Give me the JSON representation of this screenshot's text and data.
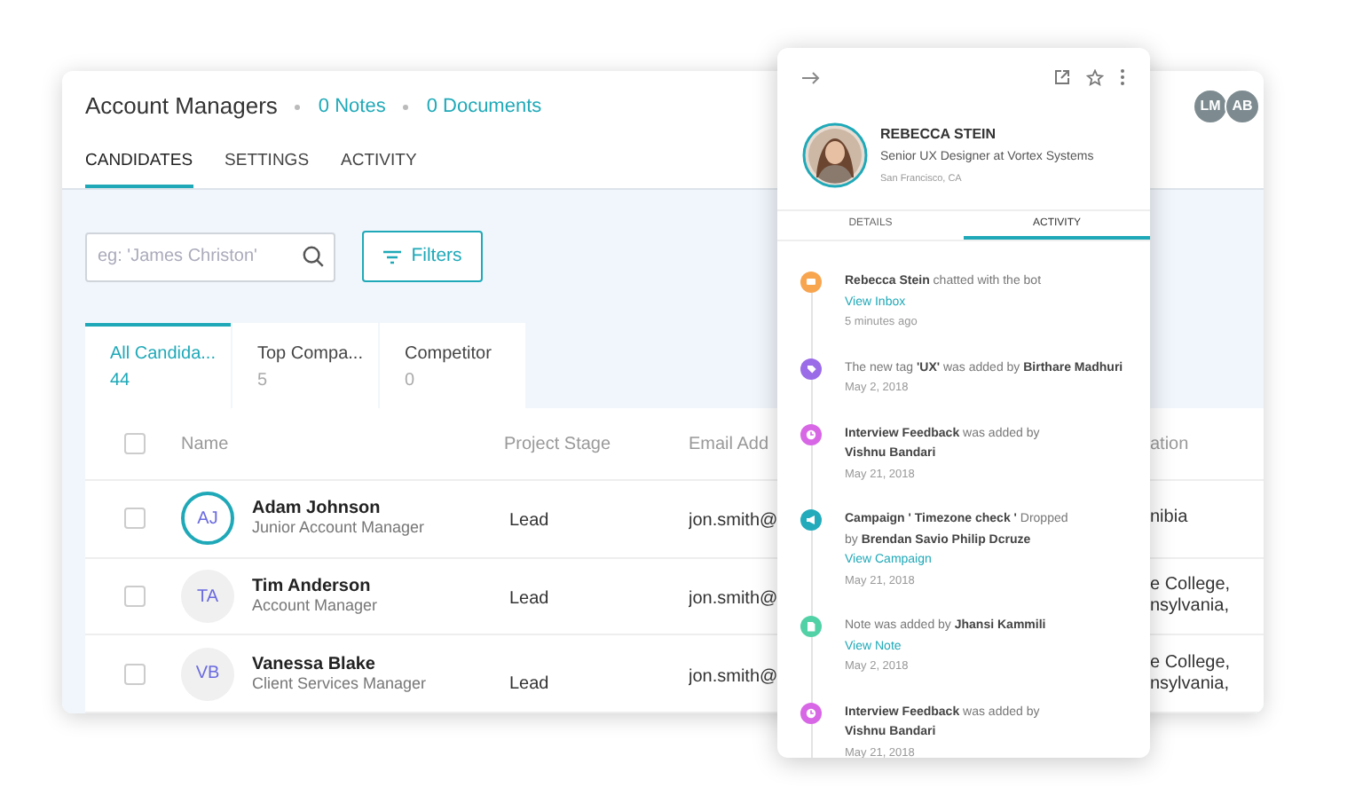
{
  "header": {
    "title": "Account Managers",
    "links": [
      "0 Notes",
      "0 Documents"
    ],
    "avatars": [
      "LM",
      "AB"
    ]
  },
  "tabs": [
    {
      "label": "CANDIDATES",
      "selected": true
    },
    {
      "label": "SETTINGS",
      "selected": false
    },
    {
      "label": "ACTIVITY",
      "selected": false
    }
  ],
  "search": {
    "placeholder": "eg: 'James Christon'"
  },
  "filters_button": "Filters",
  "segments": [
    {
      "label": "All Candida...",
      "count": "44",
      "selected": true
    },
    {
      "label": "Top Compa...",
      "count": "5",
      "selected": false
    },
    {
      "label": "Competitor",
      "count": "0",
      "selected": false
    }
  ],
  "table": {
    "select_all_checked": false,
    "columns": [
      "Name",
      "Project Stage",
      "Email Add",
      "ation"
    ],
    "rows": [
      {
        "checked": false,
        "selected": true,
        "initials": "AJ",
        "name": "Adam Johnson",
        "role": "Junior Account Manager",
        "stage": "Lead",
        "email": "jon.smith@",
        "column_4": [
          "nibia"
        ]
      },
      {
        "checked": false,
        "selected": false,
        "initials": "TA",
        "name": "Tim Anderson",
        "role": "Account Manager",
        "stage": "Lead",
        "email": "jon.smith@",
        "column_4": [
          "e College,",
          "nsylvania,"
        ]
      },
      {
        "checked": false,
        "selected": false,
        "initials": "VB",
        "name": "Vanessa Blake",
        "role": "Client Services Manager",
        "stage": "Lead",
        "email": "jon.smith@",
        "column_4": [
          "e College,",
          "nsylvania,"
        ]
      }
    ]
  },
  "panel": {
    "profile": {
      "name": "REBECCA STEIN",
      "title": "Senior UX Designer at Vortex Systems",
      "location": "San Francisco, CA"
    },
    "tabs": [
      {
        "label": "DETAILS",
        "selected": false
      },
      {
        "label": "ACTIVITY",
        "selected": true
      }
    ],
    "activity": [
      {
        "kind": "chat",
        "color": "#f8a550",
        "lines": [
          "**Rebecca Stein** chatted with the bot"
        ],
        "link": "View Inbox",
        "time": "5 minutes ago"
      },
      {
        "kind": "tag",
        "color": "#9b6ce8",
        "lines": [
          "The new tag **'UX'** was added by **Birthare Madhuri**"
        ],
        "time": "May 2, 2018"
      },
      {
        "kind": "feedback",
        "color": "#d867e6",
        "lines": [
          "**Interview Feedback** was added by",
          "**Vishnu Bandari**"
        ],
        "time": "May 21, 2018"
      },
      {
        "kind": "campaign",
        "color": "#23abbb",
        "lines": [
          "**Campaign ' Timezone check '** Dropped",
          "by **Brendan Savio Philip Dcruze**"
        ],
        "link": "View Campaign",
        "time": "May 21, 2018"
      },
      {
        "kind": "note",
        "color": "#52d1a6",
        "lines": [
          "Note was added by **Jhansi Kammili**"
        ],
        "link": "View Note",
        "time": "May 2, 2018"
      },
      {
        "kind": "feedback",
        "color": "#d867e6",
        "lines": [
          "**Interview Feedback** was added by",
          "**Vishnu Bandari**"
        ],
        "time": "May 21, 2018"
      }
    ]
  }
}
